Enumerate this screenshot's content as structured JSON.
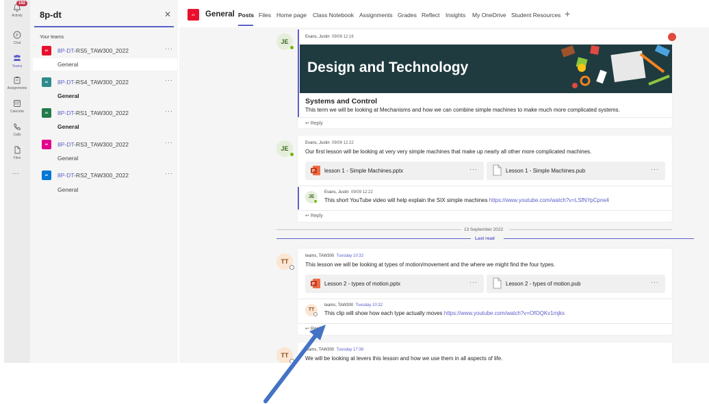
{
  "rail": {
    "badge": "192",
    "items": [
      {
        "label": "Activity",
        "icon": "bell-icon"
      },
      {
        "label": "Chat",
        "icon": "chat-icon"
      },
      {
        "label": "Teams",
        "icon": "teams-icon"
      },
      {
        "label": "Assignments",
        "icon": "assignments-icon"
      },
      {
        "label": "Calendar",
        "icon": "calendar-icon"
      },
      {
        "label": "Calls",
        "icon": "phone-icon"
      },
      {
        "label": "Files",
        "icon": "file-icon"
      }
    ],
    "more": "···"
  },
  "panel": {
    "title": "8p-dt",
    "close": "✕",
    "section": "Your teams",
    "teams": [
      {
        "prefix": "8P-DT",
        "suffix": "-RS5_TAW300_2022",
        "avatar": "82",
        "color": "#e8112d",
        "channel": "General",
        "channel_bold": false
      },
      {
        "prefix": "8P-DT",
        "suffix": "-RS4_TAW300_2022",
        "avatar": "82",
        "color": "#2e8b8b",
        "channel": "General",
        "channel_bold": true
      },
      {
        "prefix": "8P-DT",
        "suffix": "-RS1_TAW300_2022",
        "avatar": "82",
        "color": "#237b4b",
        "channel": "General",
        "channel_bold": true
      },
      {
        "prefix": "8P-DT",
        "suffix": "-RS3_TAW300_2022",
        "avatar": "82",
        "color": "#e3008c",
        "channel": "General",
        "channel_bold": false
      },
      {
        "prefix": "8P-DT",
        "suffix": "-RS2_TAW300_2022",
        "avatar": "82",
        "color": "#0078d4",
        "channel": "General",
        "channel_bold": false
      }
    ],
    "more": "···"
  },
  "header": {
    "avatar": "82",
    "title": "General",
    "tabs": [
      "Posts",
      "Files",
      "Home page",
      "Class Notebook",
      "Assignments",
      "Grades",
      "Reflect",
      "Insights",
      "My OneDrive",
      "Student Resources"
    ],
    "add": "+"
  },
  "feed": {
    "post1": {
      "avatar": "JE",
      "author": "Evans, Justin",
      "time": "09/09 12:16",
      "banner_title": "Design and Technology",
      "heading": "Systems and Control",
      "text": "This term we will be looking at Mechanisms and how we can combine simple machines to make much more complicated systems.",
      "reply": "Reply"
    },
    "post2": {
      "avatar": "JE",
      "author": "Evans, Justin",
      "time": "09/09 12:22",
      "text": "Our first lesson will be looking at very very simple machines that make up nearly all other more complicated machines.",
      "file1": "lesson 1 - Simple Machines.pptx",
      "file2": "Lesson 1 - Simple Machines.pub",
      "reply_author": "Evans, Justin",
      "reply_time": "09/09 12:22",
      "reply_text": "This short YouTube video will help explain the SIX simple machines ",
      "reply_link": "https://www.youtube.com/watch?v=LSfNYpCprw4",
      "reply": "Reply"
    },
    "date_divider": "13 September 2022",
    "last_read": "Last read",
    "post3": {
      "avatar": "TT",
      "author": "teams, TAW300",
      "time": "Tuesday 10:32",
      "text": "This lesson we will be looking at types of motion/movement and the where we might find the four types.",
      "file1": "Lesson 2 - types of motion.pptx",
      "file2": "Lesson 2 - types of motion.pub",
      "reply_author": "teams, TAW300",
      "reply_time": "Tuesday 10:32",
      "reply_text": "This clip will show how each type actually moves ",
      "reply_link": "https://www.youtube.com/watch?v=OfOQKv1mjks",
      "reply": "Reply"
    },
    "post4": {
      "avatar": "TT",
      "author": "teams, TAW300",
      "time": "Tuesday 17:38",
      "text": "We will be looking at levers this lesson and how we use them in all aspects of life."
    },
    "file_more": "···"
  },
  "colors": {
    "accent": "#5b5fc7",
    "banner": "#1f3b40",
    "arrow": "#4472c4"
  }
}
